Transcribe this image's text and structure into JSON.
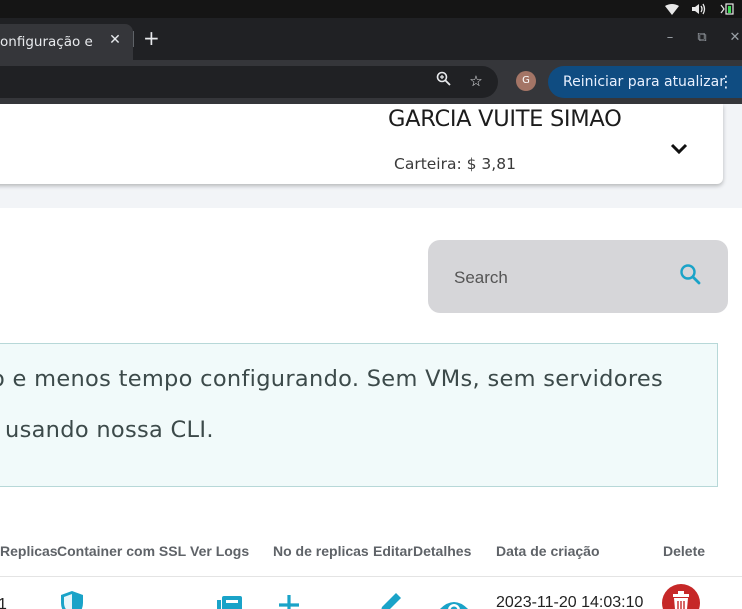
{
  "browser": {
    "tab_title": "onfiguração e",
    "update_button_label": "Reiniciar para atualizar",
    "profile_initial": "G"
  },
  "header": {
    "user_name": "GARCIA VUITE SIMAO",
    "wallet_label": "Carteira: $ 3,81"
  },
  "search": {
    "placeholder": "Search"
  },
  "banner": {
    "line1": "o e menos tempo configurando. Sem VMs, sem servidores",
    "line2": "l usando nossa CLI."
  },
  "table": {
    "headers": [
      "Replicas",
      "Container com SSL",
      "Ver Logs",
      "No de replicas",
      "Editar",
      "Detalhes",
      "Data de criação",
      "Delete"
    ],
    "rows": [
      {
        "replicas": "1",
        "created": "2023-11-20 14:03:10"
      }
    ]
  },
  "colors": {
    "accent": "#1aa3c8",
    "delete": "#c62828",
    "update_button": "#0f4c81"
  },
  "icons": {
    "ssl": "shield-icon",
    "logs": "logs-icon",
    "add_replica": "plus-icon",
    "edit": "pencil-icon",
    "details": "eye-icon",
    "delete": "trash-icon"
  }
}
